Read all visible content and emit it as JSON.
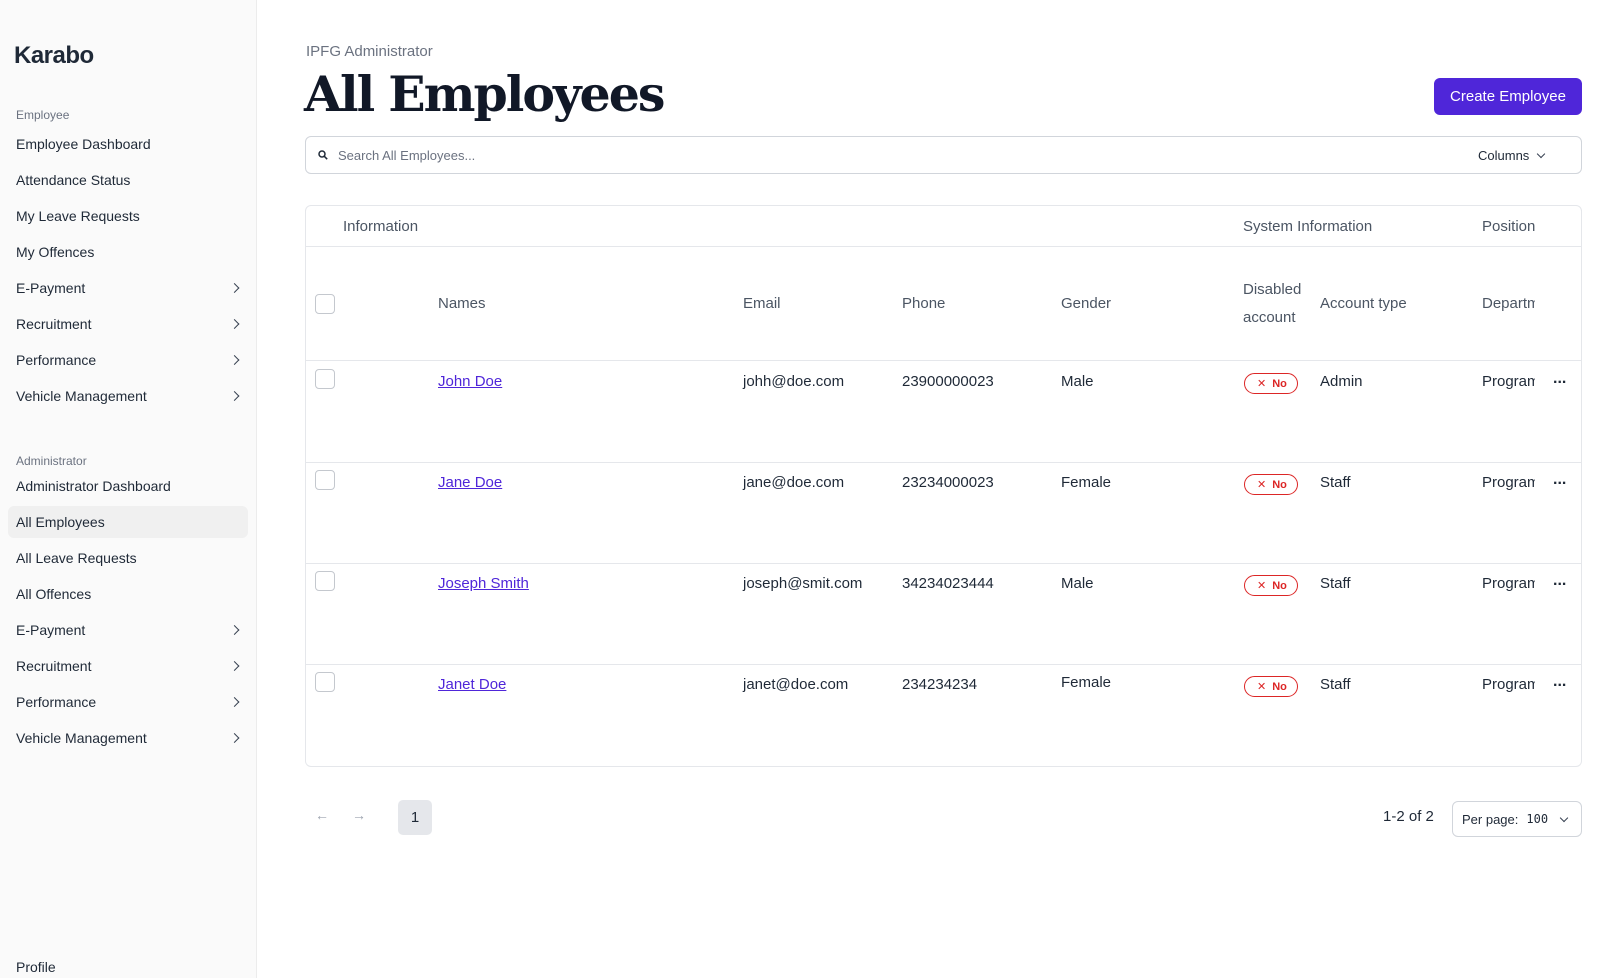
{
  "app": {
    "brand": "Karabo"
  },
  "sidebar": {
    "employee_section": "Employee",
    "employee_items": [
      {
        "label": "Employee Dashboard",
        "has_submenu": false
      },
      {
        "label": "Attendance Status",
        "has_submenu": false
      },
      {
        "label": "My Leave Requests",
        "has_submenu": false
      },
      {
        "label": "My Offences",
        "has_submenu": false
      },
      {
        "label": "E-Payment",
        "has_submenu": true
      },
      {
        "label": "Recruitment",
        "has_submenu": true
      },
      {
        "label": "Performance",
        "has_submenu": true
      },
      {
        "label": "Vehicle Management",
        "has_submenu": true
      }
    ],
    "admin_section": "Administrator",
    "admin_items": [
      {
        "label": "Administrator Dashboard",
        "has_submenu": false
      },
      {
        "label": "All Employees",
        "has_submenu": false,
        "active": true
      },
      {
        "label": "All Leave Requests",
        "has_submenu": false
      },
      {
        "label": "All Offences",
        "has_submenu": false
      },
      {
        "label": "E-Payment",
        "has_submenu": true
      },
      {
        "label": "Recruitment",
        "has_submenu": true
      },
      {
        "label": "Performance",
        "has_submenu": true
      },
      {
        "label": "Vehicle Management",
        "has_submenu": true
      }
    ],
    "footer_item": "Profile"
  },
  "header": {
    "breadcrumb": "IPFG Administrator",
    "title": "All Employees",
    "create_button": "Create Employee"
  },
  "search": {
    "placeholder": "Search All Employees...",
    "value": "",
    "columns_label": "Columns"
  },
  "table": {
    "groups": {
      "information": "Information",
      "system_information": "System Information",
      "position": "Position"
    },
    "columns": {
      "names": "Names",
      "email": "Email",
      "phone": "Phone",
      "gender": "Gender",
      "disabled_line1": "Disabled",
      "disabled_line2": "account",
      "account_type": "Account type",
      "department": "Department"
    },
    "rows": [
      {
        "name": "John Doe",
        "email": "johh@doe.com",
        "phone": "23900000023",
        "gender": "Male",
        "disabled": "No",
        "account_type": "Admin",
        "department": "Program"
      },
      {
        "name": "Jane Doe",
        "email": "jane@doe.com",
        "phone": "23234000023",
        "gender": "Female",
        "disabled": "No",
        "account_type": "Staff",
        "department": "Program"
      },
      {
        "name": "Joseph Smith",
        "email": "joseph@smit.com",
        "phone": "34234023444",
        "gender": "Male",
        "disabled": "No",
        "account_type": "Staff",
        "department": "Program"
      },
      {
        "name": "Janet Doe",
        "email": "janet@doe.com",
        "phone": "234234234",
        "gender": "Female",
        "disabled": "No",
        "account_type": "Staff",
        "department": "Program"
      }
    ],
    "row_actions": "..."
  },
  "pagination": {
    "prev": "←",
    "next": "→",
    "current_page": "1",
    "range": "1-2 of 2",
    "per_page_label": "Per page:",
    "per_page_value": "100"
  },
  "colors": {
    "accent": "#4f26d9",
    "danger": "#dc2626",
    "sidebar_bg": "#fafafa"
  }
}
